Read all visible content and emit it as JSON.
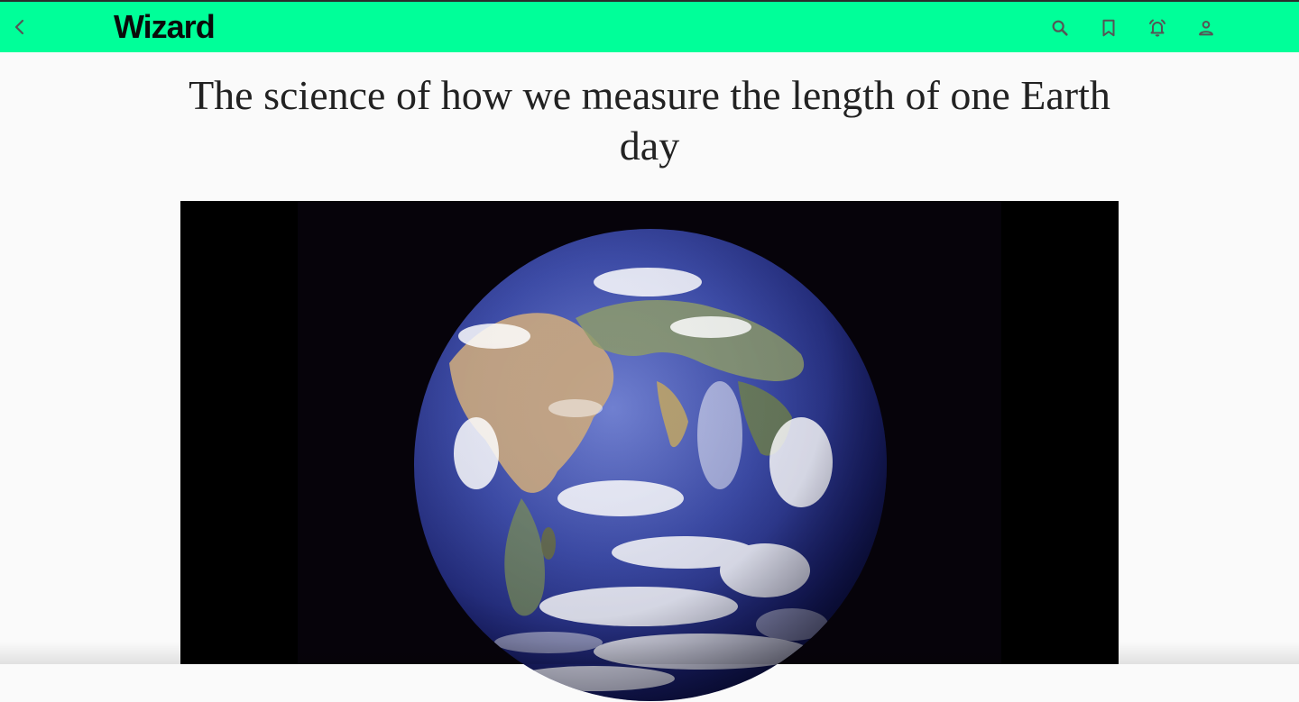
{
  "header": {
    "brand": "Wizard",
    "background_color": "#00ff99",
    "back_icon": "chevron-left-icon",
    "actions": [
      {
        "name": "search",
        "icon": "search-icon"
      },
      {
        "name": "bookmark",
        "icon": "bookmark-icon"
      },
      {
        "name": "notifications",
        "icon": "alarm-bell-icon"
      },
      {
        "name": "account",
        "icon": "person-icon"
      }
    ]
  },
  "article": {
    "title": "The science of how we measure the length of one Earth day",
    "media": {
      "kind": "image",
      "subject": "earth-globe-image"
    }
  }
}
